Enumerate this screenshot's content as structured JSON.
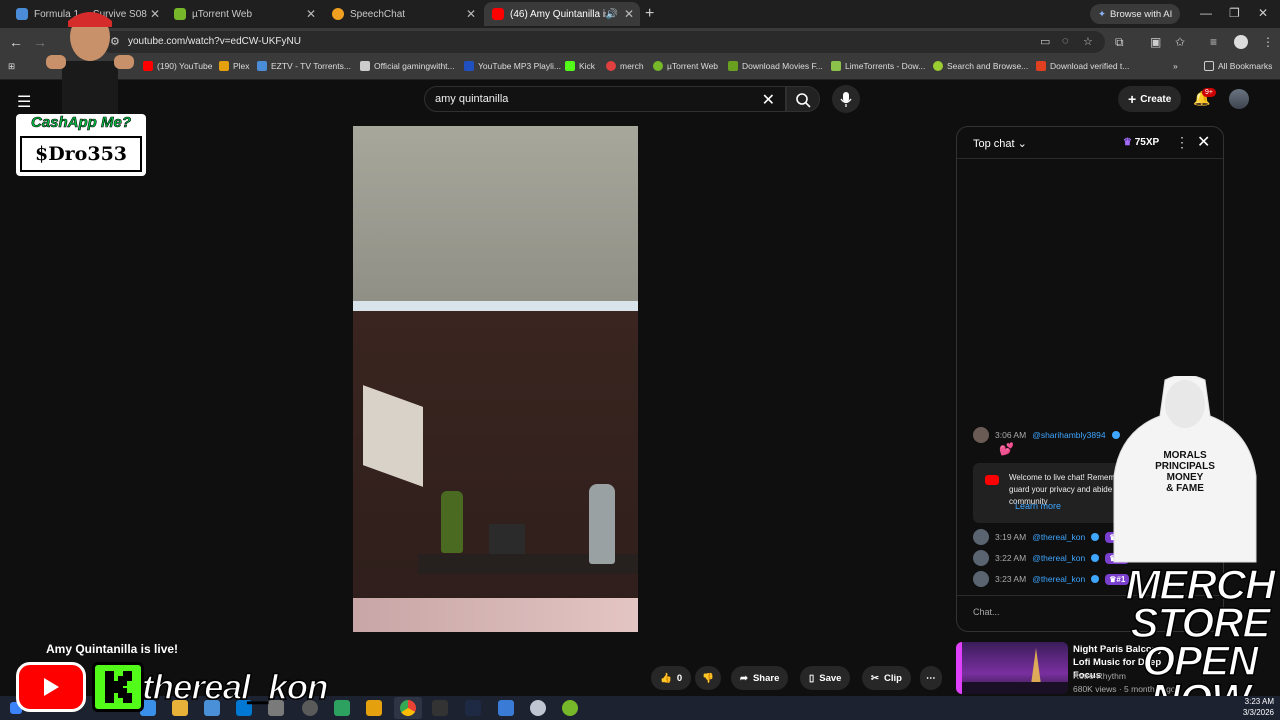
{
  "browser": {
    "tabs": [
      {
        "label": "Formula 1 ... Survive S08",
        "favicon_color": "#4a8cd8"
      },
      {
        "label": "µTorrent Web",
        "favicon_color": "#76b82a"
      },
      {
        "label": "SpeechChat",
        "favicon_color": "#f0a020"
      },
      {
        "label": "(46) Amy Quintanilla is live!",
        "favicon_color": "#ff0000"
      }
    ],
    "ai_button": "Browse with AI",
    "url": "youtube.com/watch?v=edCW-UKFyNU",
    "bookmarks": [
      {
        "label": "(190) YouTube",
        "color": "#ff0000"
      },
      {
        "label": "Plex",
        "color": "#e5a00d"
      },
      {
        "label": "EZTV - TV Torrents...",
        "color": "#4a8cd8"
      },
      {
        "label": "Official gamingwitht...",
        "color": "#cccccc"
      },
      {
        "label": "YouTube MP3 Playli...",
        "color": "#2050c0"
      },
      {
        "label": "Kick",
        "color": "#53fc18"
      },
      {
        "label": "merch",
        "color": "#e04040"
      },
      {
        "label": "µTorrent Web",
        "color": "#76b82a"
      },
      {
        "label": "Download Movies F...",
        "color": "#6aa020"
      },
      {
        "label": "LimeTorrents - Dow...",
        "color": "#8bc34a"
      },
      {
        "label": "Search and Browse...",
        "color": "#9acd32"
      },
      {
        "label": "Download verified t...",
        "color": "#e04020"
      }
    ],
    "all_bookmarks": "All Bookmarks"
  },
  "youtube": {
    "search_query": "amy quintanilla",
    "create_label": "Create",
    "notification_badge": "9+",
    "live_title": "Amy Quintanilla is live!",
    "actions": {
      "likes": "0",
      "share": "Share",
      "save": "Save",
      "clip": "Clip"
    }
  },
  "chat": {
    "title": "Top chat",
    "xp": "75XP",
    "messages": [
      {
        "time": "3:06 AM",
        "author": "@sharihambly3894",
        "text": "💕"
      },
      {
        "time": "3:19 AM",
        "author": "@thereal_kon",
        "rank": "#1"
      },
      {
        "time": "3:22 AM",
        "author": "@thereal_kon",
        "rank": "#1"
      },
      {
        "time": "3:23 AM",
        "author": "@thereal_kon",
        "rank": "#1"
      }
    ],
    "welcome_text": "Welcome to live chat! Remember to guard your privacy and abide by our community",
    "learn_more": "Learn more",
    "input_placeholder": "Chat..."
  },
  "recommendation": {
    "title": "Night Paris Balcony Lofi Music for Deep Focus",
    "channel": "Retro-Rhythm",
    "meta": "680K views · 5 months ago"
  },
  "overlays": {
    "cashapp_prompt": "CashApp Me?",
    "cashapp_tag": "$Dro353",
    "merch_lines": [
      "MERCH",
      "STORE",
      "OPEN",
      "NOW"
    ],
    "hoodie_print": [
      "MORALS",
      "PRINCIPALS",
      "MONEY",
      "& FAME"
    ],
    "streamer_name": "thereal_kon"
  },
  "taskbar": {
    "time": "3:23 AM",
    "date": "3/3/2026"
  }
}
